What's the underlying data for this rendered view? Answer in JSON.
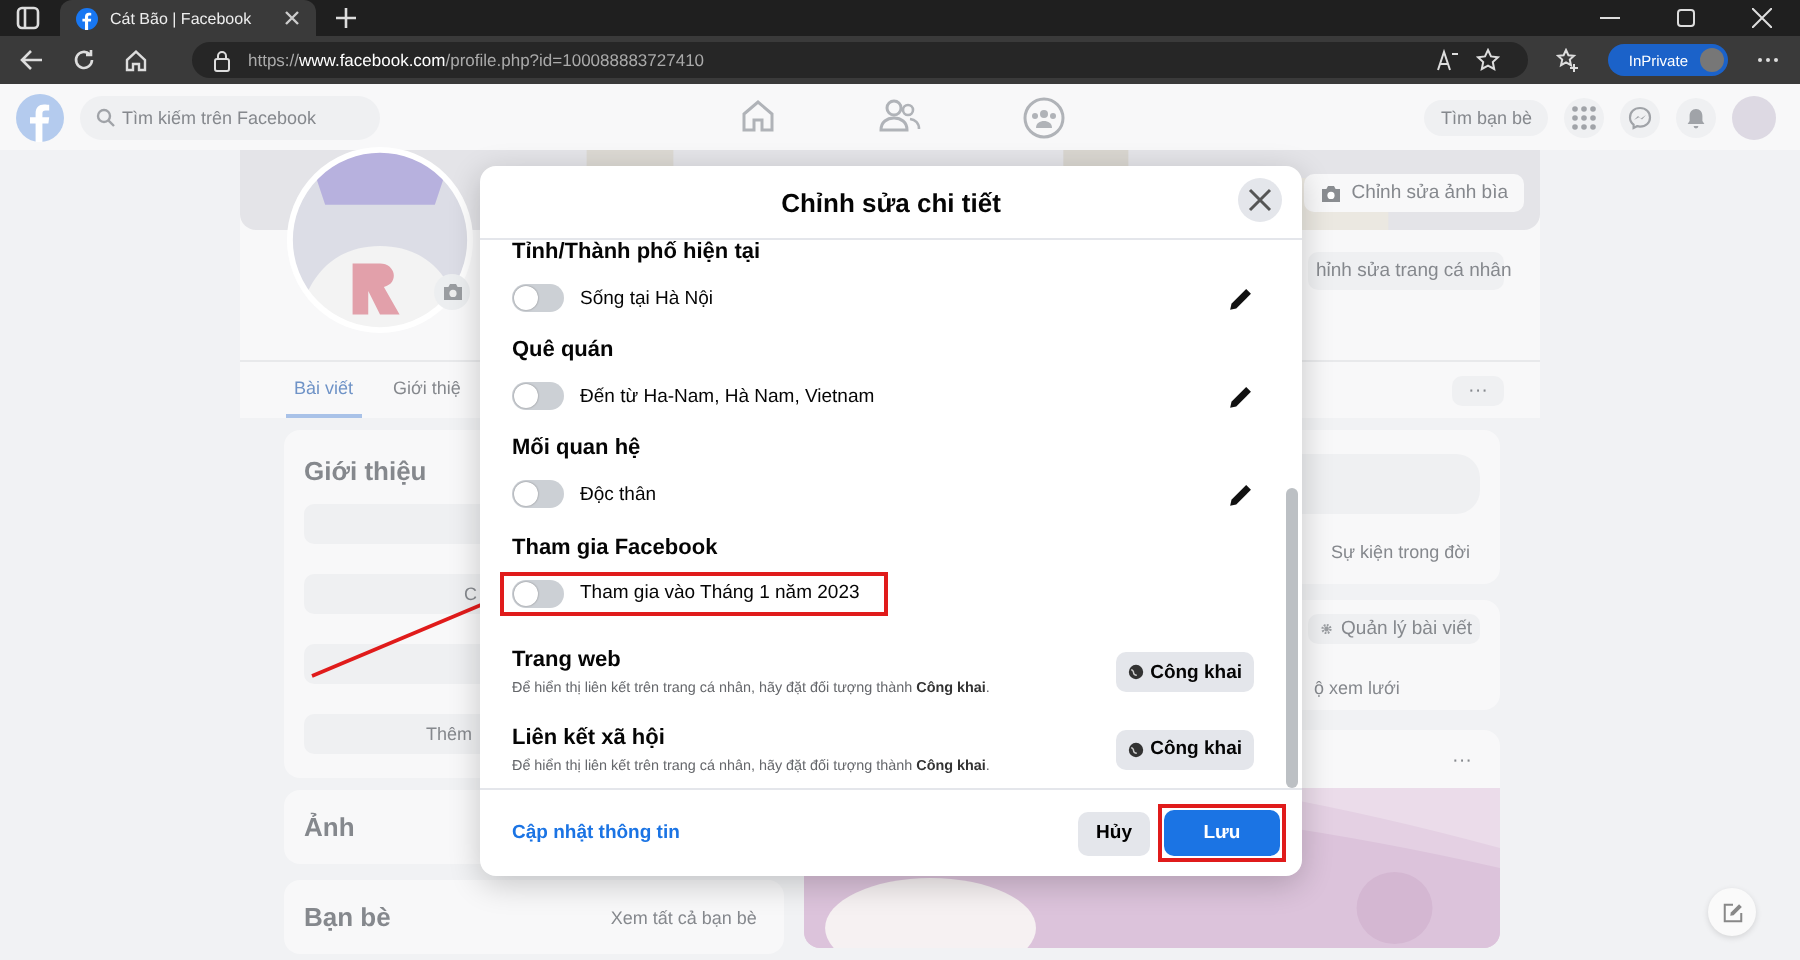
{
  "browser": {
    "tab_title": "Cát Bão | Facebook",
    "url_prefix": "https://",
    "url_host": "www.facebook.com",
    "url_path": "/profile.php?id=100088883727410",
    "inprivate": "InPrivate"
  },
  "facebook_nav": {
    "search_placeholder": "Tìm kiếm trên Facebook",
    "find_friends": "Tìm bạn bè"
  },
  "profile": {
    "edit_cover": "Chỉnh sửa ảnh bìa",
    "edit_profile": "hỉnh sửa trang cá nhân",
    "tabs": [
      {
        "label": "Bài viết",
        "selected": true
      },
      {
        "label": "Giới thiệ",
        "selected": false
      }
    ],
    "more": "···",
    "intro_title": "Giới thiệu",
    "intro_button_1": "C",
    "intro_button_2": "Thêm",
    "life_events": "Sự kiện trong đời",
    "manage_posts": "Quản lý bài viết",
    "grid_view": "ộ xem lưới",
    "post_more": "···",
    "photos_title": "Ảnh",
    "friends_title": "Bạn bè",
    "see_all_friends": "Xem tất cả bạn bè"
  },
  "modal": {
    "title": "Chỉnh sửa chi tiết",
    "sections": [
      {
        "kind": "toggle",
        "heading": "Tỉnh/Thành phố hiện tại",
        "value": "Sống tại Hà Nội",
        "on": false,
        "editable": true,
        "highlighted": false
      },
      {
        "kind": "toggle",
        "heading": "Quê quán",
        "value": "Đến từ Ha-Nam, Hà Nam, Vietnam",
        "on": false,
        "editable": true,
        "highlighted": false
      },
      {
        "kind": "toggle",
        "heading": "Mối quan hệ",
        "value": "Độc thân",
        "on": false,
        "editable": true,
        "highlighted": false
      },
      {
        "kind": "toggle",
        "heading": "Tham gia Facebook",
        "value": "Tham gia vào Tháng 1 năm 2023",
        "on": false,
        "editable": false,
        "highlighted": true
      },
      {
        "kind": "audience",
        "heading": "Trang web",
        "description": "Để hiển thị liên kết trên trang cá nhân, hãy đặt đối tượng thành **Công khai**.",
        "audience": "Công khai"
      },
      {
        "kind": "audience",
        "heading": "Liên kết xã hội",
        "description": "Để hiển thị liên kết trên trang cá nhân, hãy đặt đối tượng thành **Công khai**.",
        "audience": "Công khai"
      }
    ],
    "update_link": "Cập nhật thông tin",
    "cancel": "Hủy",
    "save": "Lưu",
    "save_highlighted": true
  }
}
